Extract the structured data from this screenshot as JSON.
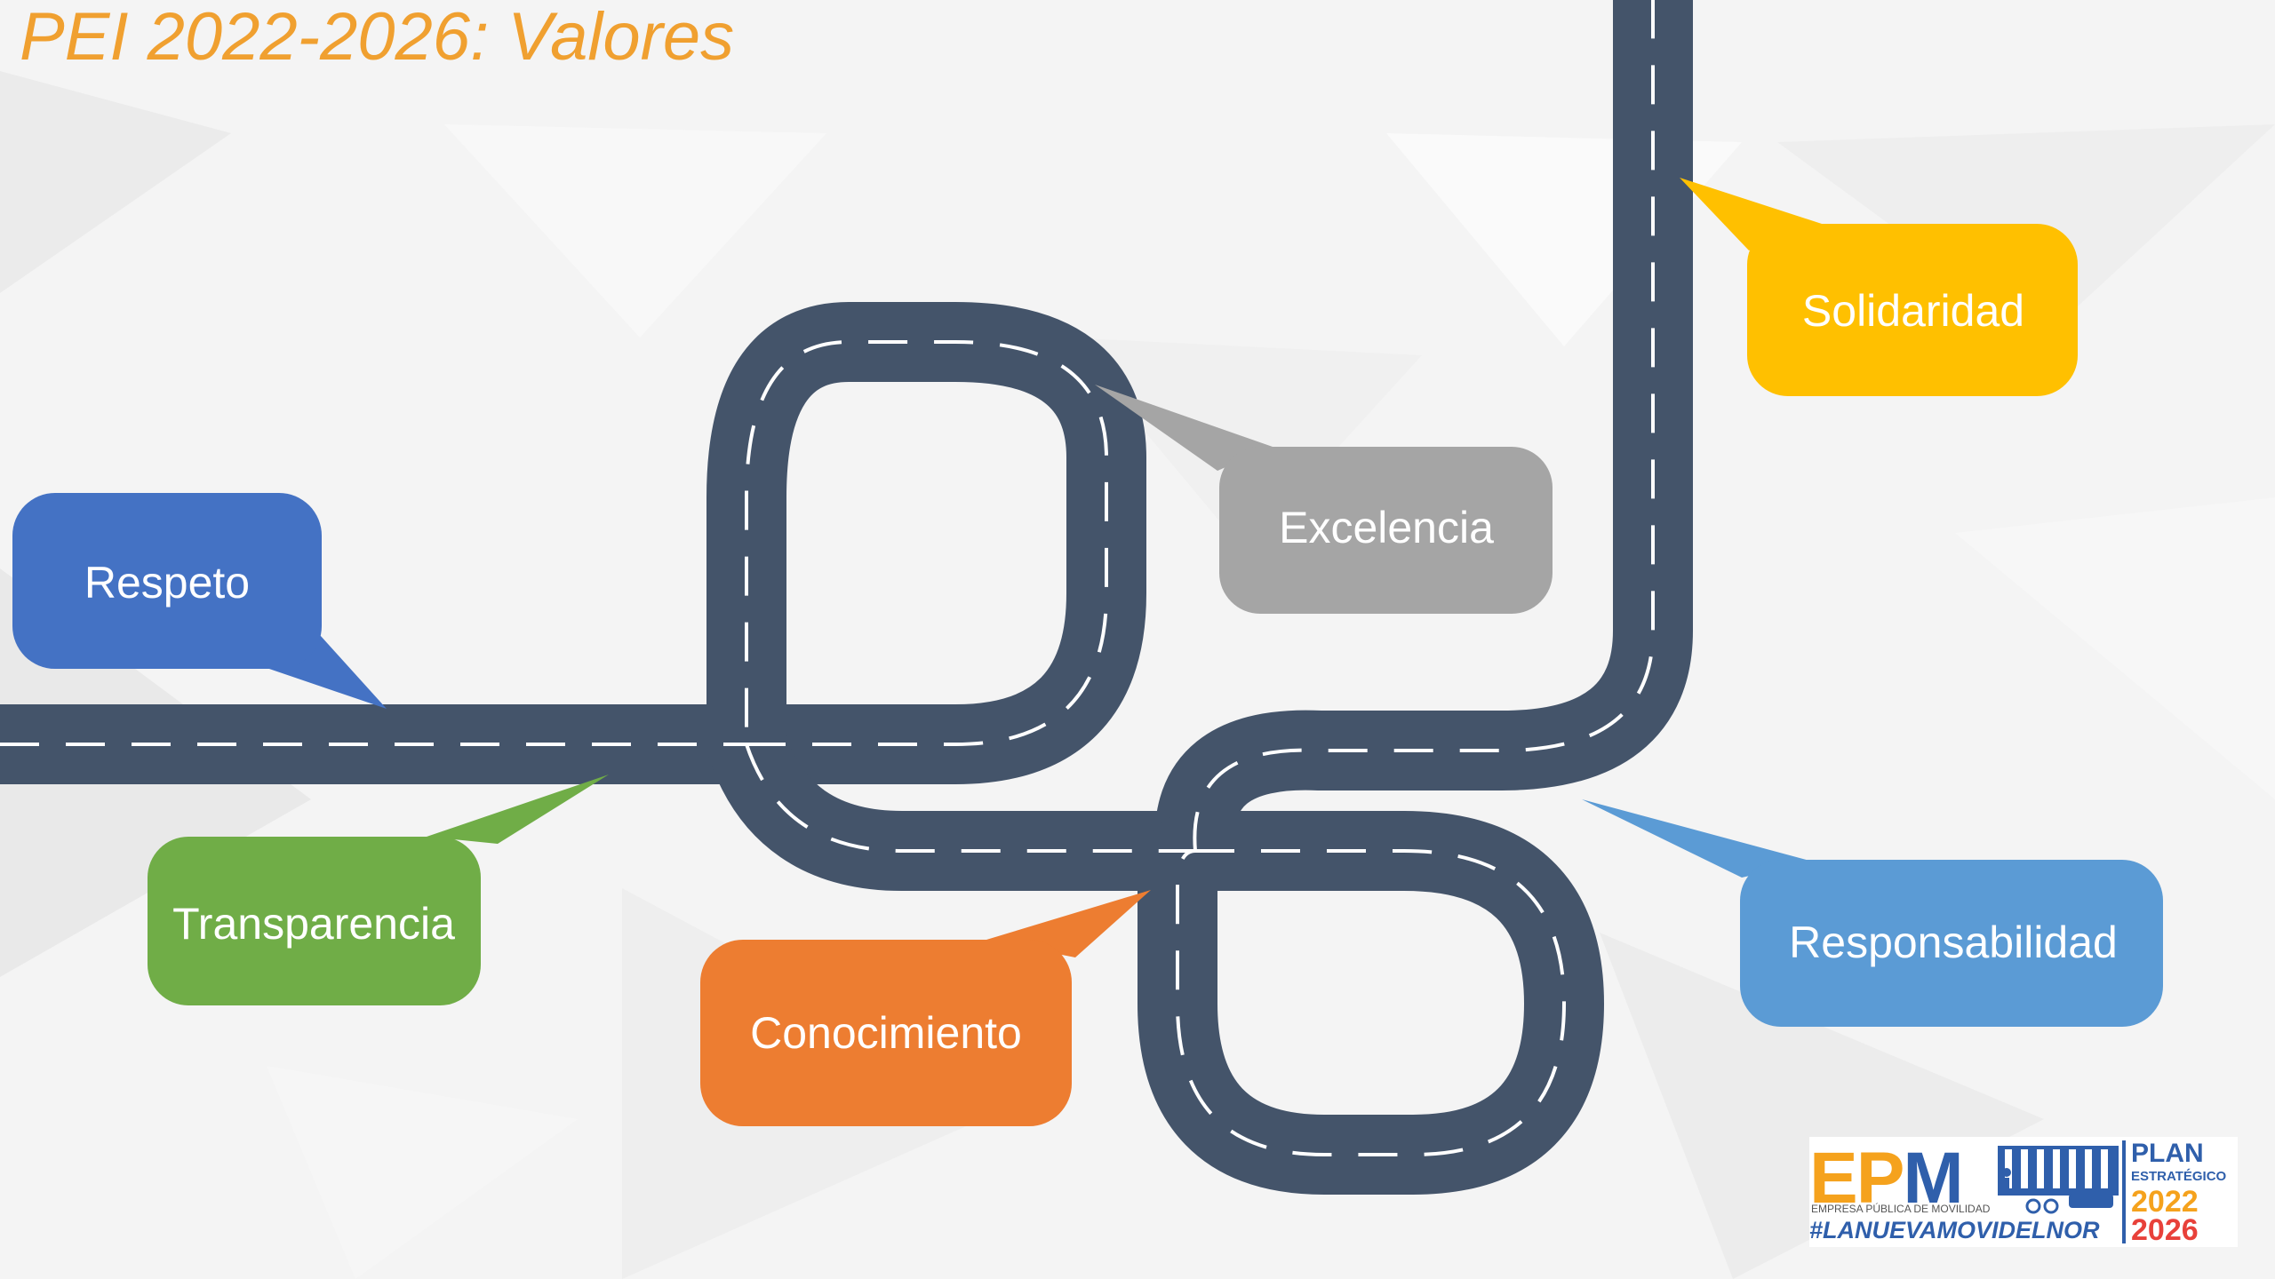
{
  "slide": {
    "title": "PEI 2022-2026: Valores"
  },
  "values": [
    {
      "key": "respeto",
      "label": "Respeto",
      "color": "#4472c4"
    },
    {
      "key": "transparencia",
      "label": "Transparencia",
      "color": "#70ad47"
    },
    {
      "key": "excelencia",
      "label": "Excelencia",
      "color": "#a5a5a5"
    },
    {
      "key": "conocimiento",
      "label": "Conocimiento",
      "color": "#ed7d31"
    },
    {
      "key": "solidaridad",
      "label": "Solidaridad",
      "color": "#ffc000"
    },
    {
      "key": "responsabilidad",
      "label": "Responsabilidad",
      "color": "#5b9bd5"
    }
  ],
  "road": {
    "color": "#44546a",
    "lane_marking_color": "#ffffff"
  },
  "logo": {
    "epm_e": "E",
    "epm_p": "P",
    "epm_m": "M",
    "subtitle": "EMPRESA PÚBLICA DE MOVILIDAD",
    "hashtag": "#LANUEVAMOVIDELNOR",
    "plan": "PLAN",
    "estrategico": "ESTRATÉGICO",
    "year_start": "2022",
    "year_end": "2026",
    "brand_blue": "#2f5fab",
    "brand_orange": "#f5a21d",
    "brand_red": "#e8413a"
  }
}
